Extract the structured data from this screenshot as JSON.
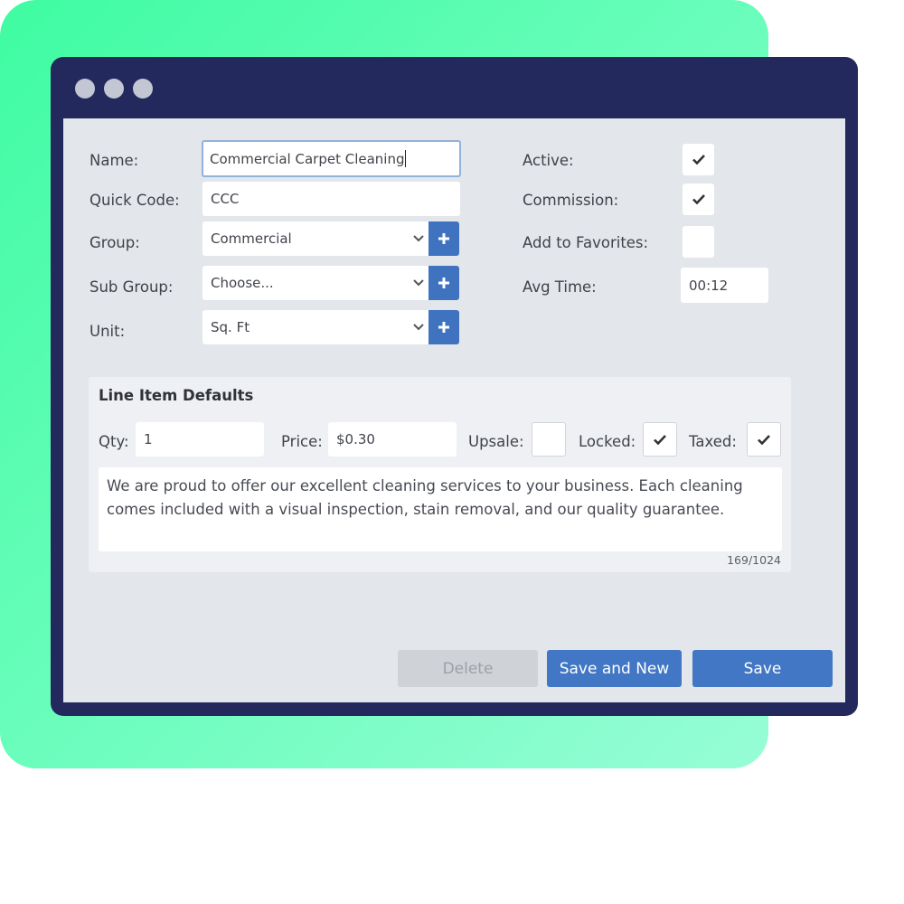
{
  "form": {
    "name_label": "Name:",
    "name_value": "Commercial Carpet Cleaning",
    "quick_code_label": "Quick Code:",
    "quick_code_value": "CCC",
    "group_label": "Group:",
    "group_value": "Commercial",
    "sub_group_label": "Sub Group:",
    "sub_group_value": "Choose...",
    "unit_label": "Unit:",
    "unit_value": "Sq. Ft",
    "add_icon": "plus-icon",
    "active_label": "Active:",
    "active_checked": true,
    "commission_label": "Commission:",
    "commission_checked": true,
    "favorites_label": "Add to Favorites:",
    "favorites_checked": false,
    "avg_time_label": "Avg Time:",
    "avg_time_value": "00:12"
  },
  "line_item_defaults": {
    "title": "Line Item Defaults",
    "qty_label": "Qty:",
    "qty_value": "1",
    "price_label": "Price:",
    "price_value": "$0.30",
    "upsale_label": "Upsale:",
    "upsale_checked": false,
    "locked_label": "Locked:",
    "locked_checked": true,
    "taxed_label": "Taxed:",
    "taxed_checked": true,
    "description": "We are proud to offer our excellent cleaning services to your business.  Each cleaning comes included with a visual inspection, stain removal, and our quality guarantee.",
    "char_count": "169/1024"
  },
  "actions": {
    "delete_label": "Delete",
    "save_new_label": "Save and New",
    "save_label": "Save"
  },
  "colors": {
    "window_frame": "#23295c",
    "accent": "#4177c4",
    "background_green": "#3ffca2"
  }
}
